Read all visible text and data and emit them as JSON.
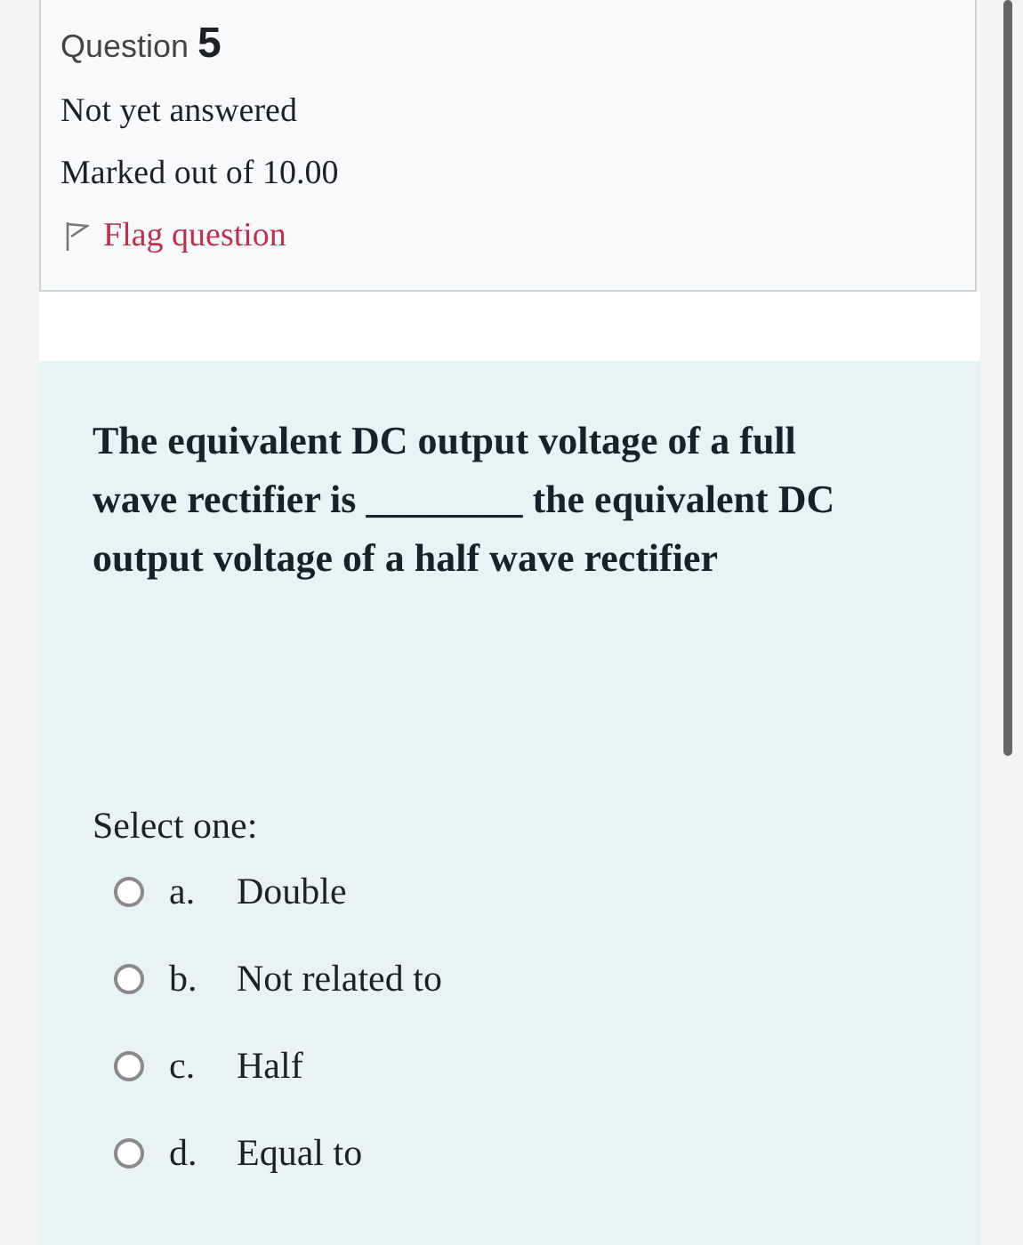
{
  "info": {
    "label": "Question",
    "number": "5",
    "state": "Not yet answered",
    "marks": "Marked out of 10.00",
    "flag": {
      "label": "Flag question",
      "flagged": false
    }
  },
  "question": {
    "text": "The equivalent DC output voltage of a full wave rectifier is ________ the equivalent DC output voltage of a half wave rectifier",
    "prompt": "Select one:",
    "options": [
      {
        "letter": "a.",
        "label": "Double",
        "selected": false
      },
      {
        "letter": "b.",
        "label": "Not related to",
        "selected": false
      },
      {
        "letter": "c.",
        "label": "Half",
        "selected": false
      },
      {
        "letter": "d.",
        "label": "Equal to",
        "selected": false
      }
    ]
  }
}
